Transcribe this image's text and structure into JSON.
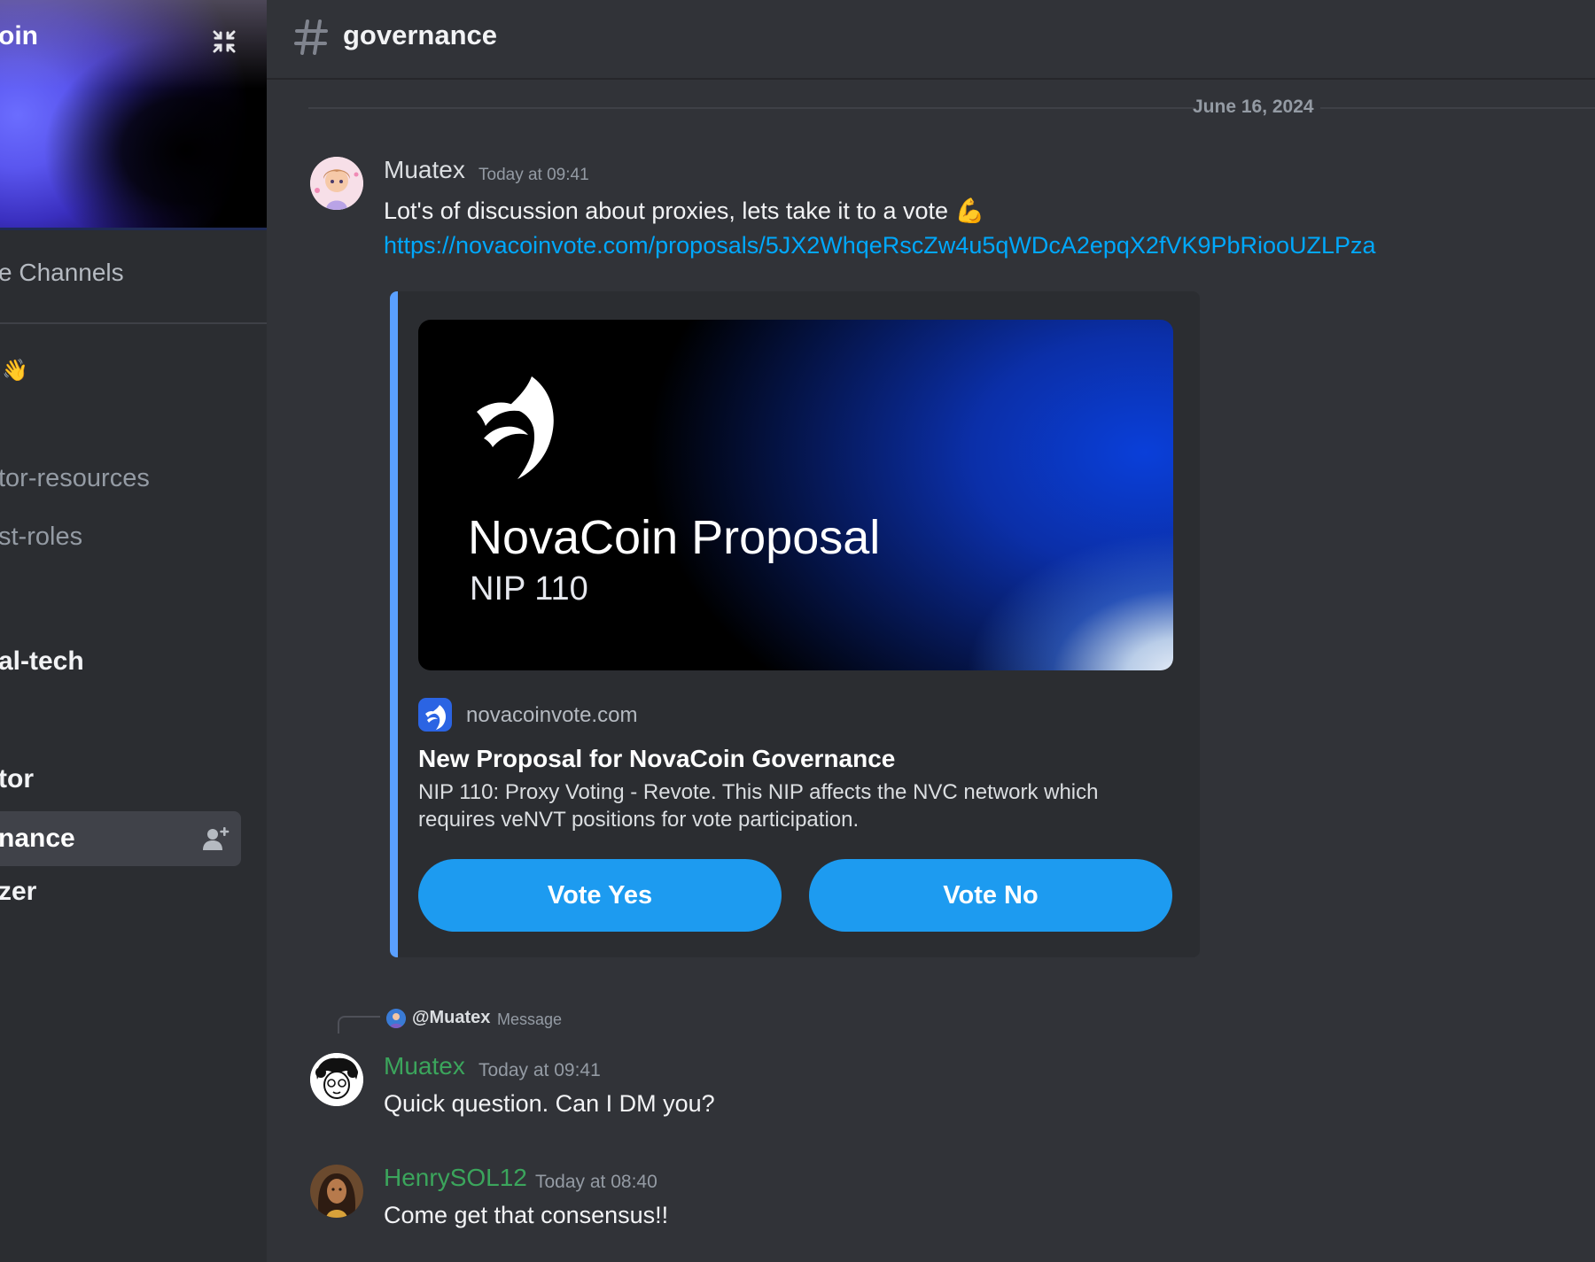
{
  "sidebar": {
    "server_name": "oin",
    "browse_channels": "e Channels",
    "wave_emoji": "👋",
    "channels": {
      "resources": "tor-resources",
      "roles": "st-roles",
      "tech": "al-tech",
      "tor": "tor",
      "active": "nance",
      "zer": "zer"
    }
  },
  "header": {
    "channel_name": "governance"
  },
  "date_divider": "June 16, 2024",
  "messages": [
    {
      "author": "Muatex",
      "timestamp": "Today at 09:41",
      "text": "Lot's of discussion about proxies, lets take it to a vote 💪",
      "link": "https://novacoinvote.com/proposals/5JX2WhqeRscZw4u5qWDcA2epqX2fVK9PbRiooUZLPza",
      "author_color": "#f2f3f5"
    },
    {
      "author": "Muatex",
      "timestamp": "Today at 09:41",
      "text": "Quick question. Can I DM you?",
      "author_color": "#3ba55c"
    },
    {
      "author": "HenrySOL12",
      "timestamp": "Today at 08:40",
      "text": "Come get that consensus!!",
      "author_color": "#3ba55c"
    }
  ],
  "embed": {
    "image_title": "NovaCoin Proposal",
    "image_subtitle": "NIP 110",
    "provider": "novacoinvote.com",
    "title": "New Proposal for NovaCoin Governance",
    "description": "NIP 110: Proxy Voting - Revote. This NIP affects the NVC network which requires veNVT positions for vote participation.",
    "vote_yes": "Vote Yes",
    "vote_no": "Vote No",
    "accent_color": "#5aa0ff",
    "button_color": "#1d9bf0"
  },
  "reply": {
    "author": "@Muatex",
    "text": "Message"
  },
  "colors": {
    "background": "#313338",
    "sidebar": "#2b2d31",
    "link": "#00a8fc",
    "username_green": "#3ba55c"
  }
}
